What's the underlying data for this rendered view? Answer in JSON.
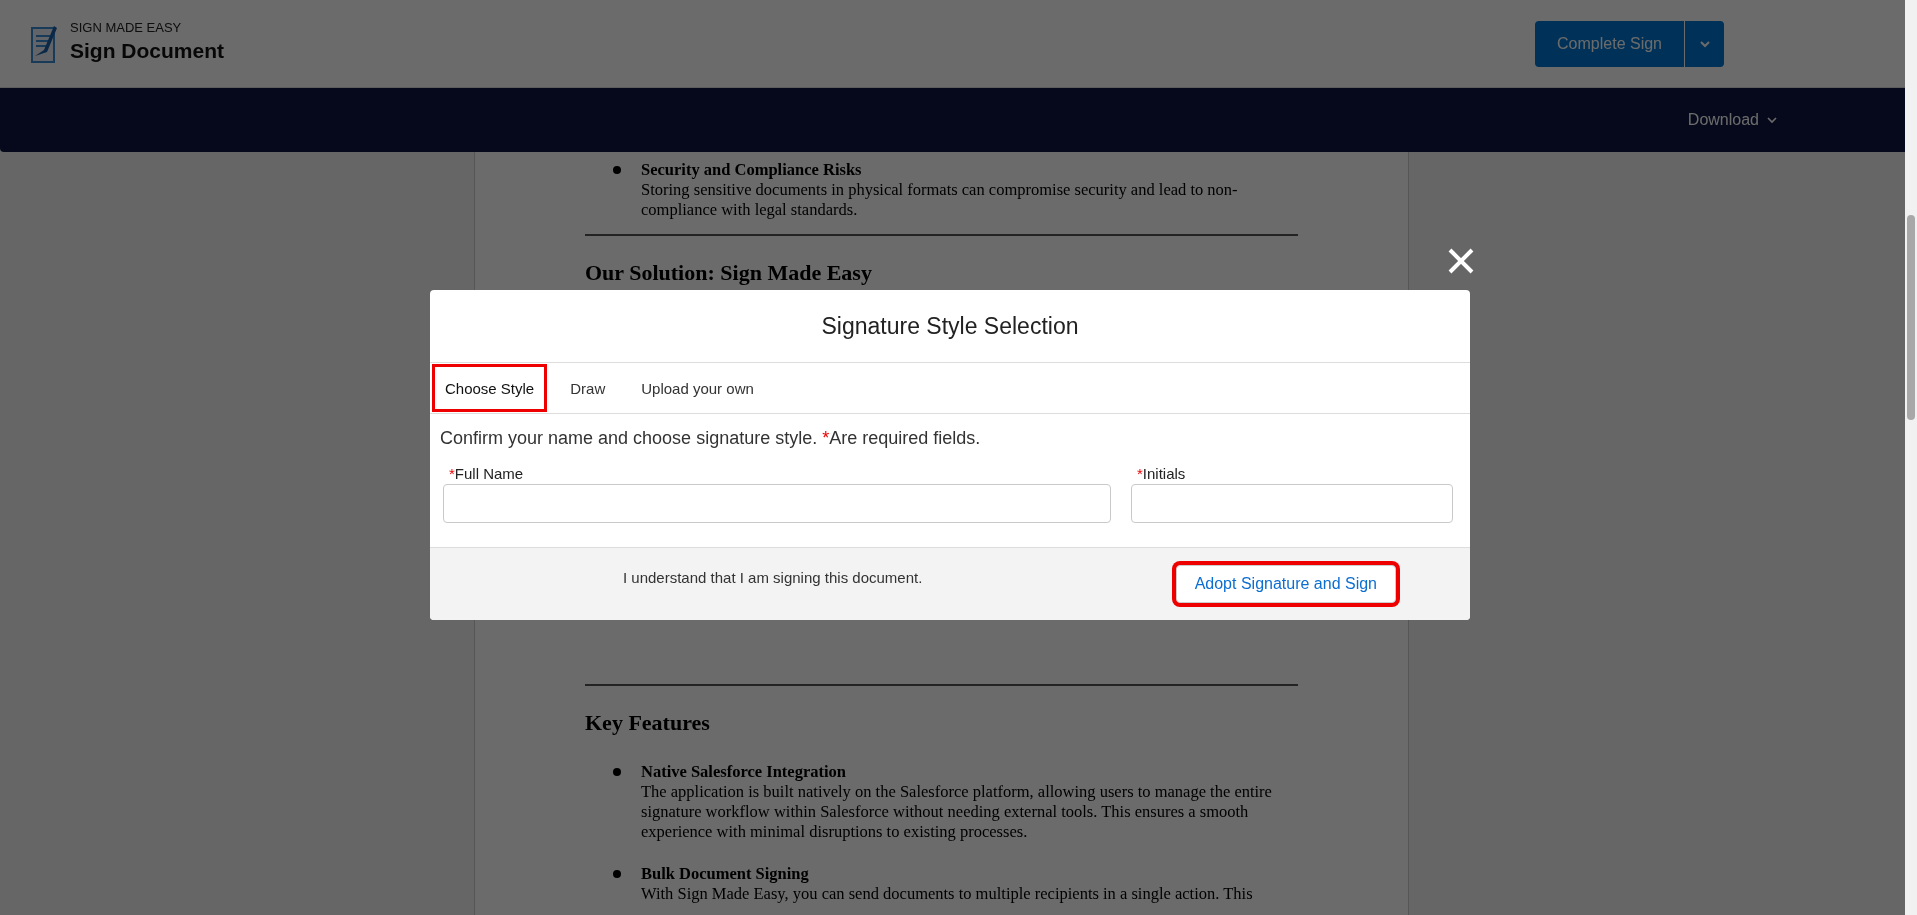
{
  "header": {
    "app_name": "SIGN MADE EASY",
    "title": "Sign Document",
    "primary_button": "Complete Sign"
  },
  "navbar": {
    "menu": "Download"
  },
  "document": {
    "top_blocks": [
      {
        "kind": "bullet",
        "title": "Security and Compliance Risks",
        "text": "Storing sensitive documents in physical formats can compromise security and lead to non-compliance with legal standards."
      },
      {
        "kind": "rule"
      },
      {
        "kind": "heading",
        "text": "Our Solution: Sign Made Easy"
      }
    ],
    "bottom_blocks": [
      {
        "kind": "rule"
      },
      {
        "kind": "heading",
        "text": "Key Features"
      },
      {
        "kind": "bullet",
        "title": "Native Salesforce Integration",
        "text": "The application is built natively on the Salesforce platform, allowing users to manage the entire signature workflow within Salesforce without needing external tools. This ensures a smooth experience with minimal disruptions to existing processes."
      },
      {
        "kind": "bullet",
        "title": "Bulk Document Signing",
        "text": "With Sign Made Easy, you can send documents to multiple recipients in a single action. This"
      }
    ]
  },
  "modal": {
    "title": "Signature Style Selection",
    "tabs": [
      {
        "label": "Choose Style",
        "selected": true,
        "highlighted": true
      },
      {
        "label": "Draw",
        "selected": false,
        "highlighted": false
      },
      {
        "label": "Upload your own",
        "selected": false,
        "highlighted": false
      }
    ],
    "prompt": "Confirm your name and choose signature style.",
    "required_mark": "*",
    "required_note": "Are required fields.",
    "fields": [
      {
        "label": "Full Name",
        "required": true
      },
      {
        "label": "Initials",
        "required": true
      }
    ],
    "consent": "I understand that I am signing this document.",
    "adopt_button": {
      "label": "Adopt Signature and Sign",
      "highlighted": true
    }
  }
}
